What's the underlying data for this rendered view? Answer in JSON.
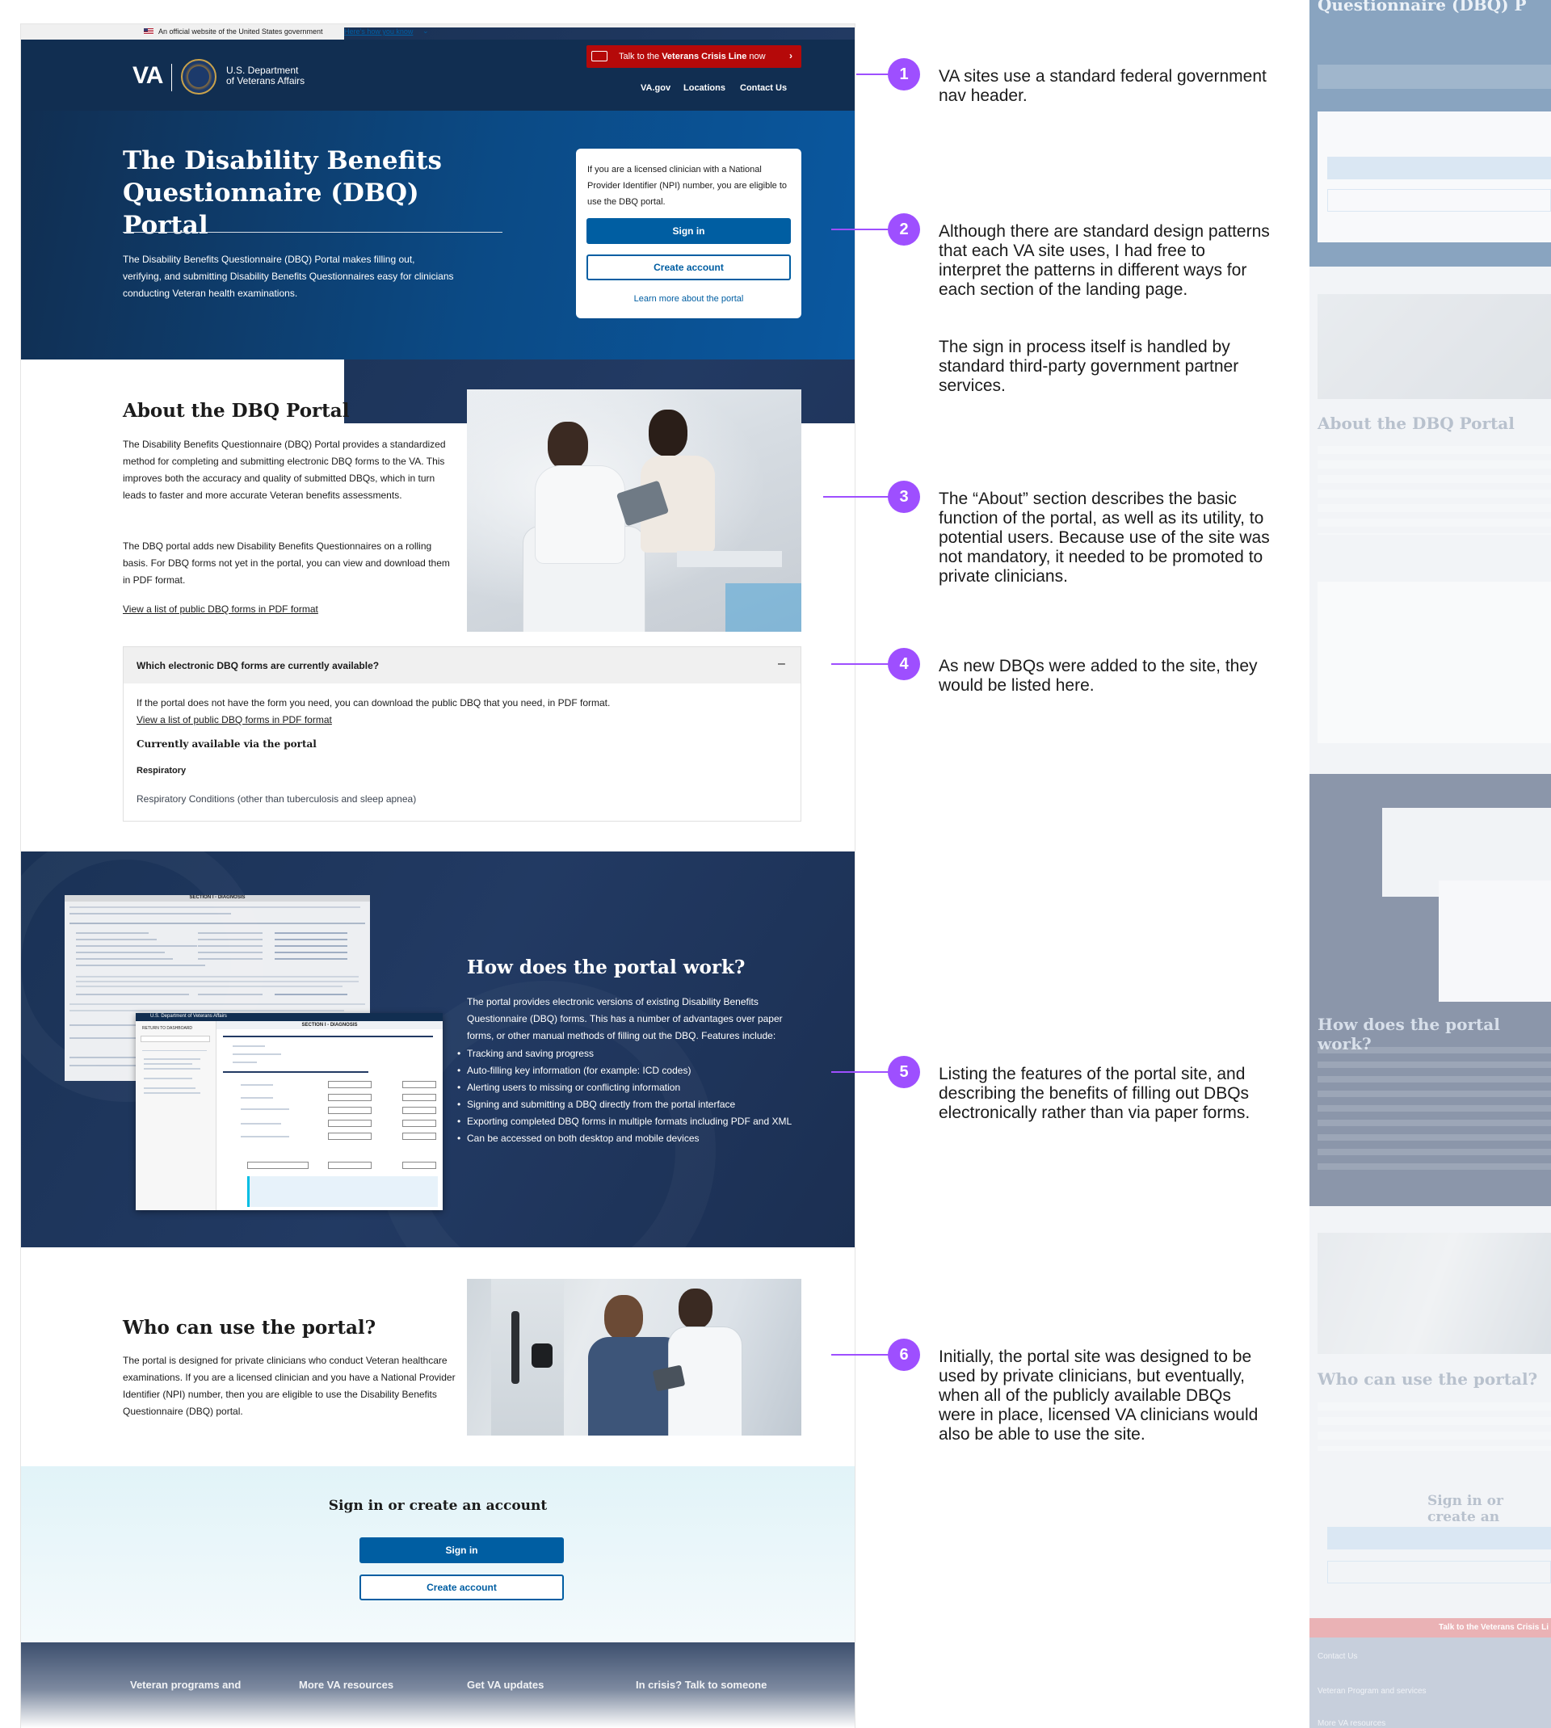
{
  "banner": {
    "text": "An official website of the United States government",
    "how_label": "Here’s how you know"
  },
  "crisis": {
    "prefix": "Talk to the ",
    "bold": "Veterans Crisis Line",
    "suffix": " now",
    "chevron": "›"
  },
  "header": {
    "logo": "VA",
    "dept_line1": "U.S. Department",
    "dept_line2": "of Veterans Affairs",
    "nav": [
      "VA.gov",
      "Locations",
      "Contact Us"
    ]
  },
  "hero": {
    "title": "The Disability Benefits Questionnaire (DBQ) Portal",
    "desc": "The Disability Benefits Questionnaire (DBQ) Portal makes filling out, verifying, and submitting Disability Benefits Questionnaires easy for clinicians conducting Veteran health examinations.",
    "card_text": "If you are a licensed clinician with a National Provider Identifier (NPI) number, you are eligible to use the DBQ portal.",
    "sign_in": "Sign in",
    "create": "Create account",
    "learn": "Learn more about the portal"
  },
  "about": {
    "title": "About the DBQ Portal",
    "p1": "The Disability Benefits Questionnaire (DBQ) Portal provides a standardized method for completing and submitting electronic DBQ forms to the VA. This improves both the accuracy and quality of submitted DBQs, which in turn leads to faster and more accurate Veteran benefits assessments.",
    "p2": "The DBQ portal adds new Disability Benefits Questionnaires on a rolling basis. For DBQ forms not yet in the portal, you can view and download them in PDF format.",
    "link": "View a list of public DBQ forms in PDF format"
  },
  "accordion": {
    "title": "Which electronic DBQ forms are currently available?",
    "toggle": "–",
    "text": "If the portal does not have the form you need, you can download the public DBQ that you need, in PDF format.",
    "link": "View a list of public DBQ forms in PDF format",
    "subhead": "Currently available via the portal",
    "category": "Respiratory",
    "item": "Respiratory Conditions (other than tuberculosis and sleep apnea)"
  },
  "how": {
    "title": "How does the portal work?",
    "intro": "The portal provides electronic versions of existing Disability Benefits Questionnaire (DBQ) forms. This has a number of advantages over paper forms, or other manual methods of filling out the DBQ. Features include:",
    "features": [
      "Tracking and saving progress",
      "Auto-filling key information (for example: ICD codes)",
      "Alerting users to missing or conflicting information",
      "Signing and submitting a DBQ directly from the portal interface",
      "Exporting completed DBQ forms in multiple formats including PDF and XML",
      "Can be accessed on both desktop and mobile devices"
    ],
    "form_header": "SECTION I - DIAGNOSIS",
    "form_brand": "U.S. Department of Veterans Affairs",
    "form_back": "RETURN TO DASHBOARD"
  },
  "who": {
    "title": "Who can use the portal?",
    "text": "The portal is designed for private clinicians who conduct Veteran healthcare examinations. If you are a licensed clinician and you have a National Provider Identifier (NPI) number, then you are eligible to use the Disability Benefits Questionnaire (DBQ) portal."
  },
  "signup": {
    "title": "Sign in or create an account",
    "sign_in": "Sign in",
    "create": "Create account"
  },
  "footer": {
    "cols": [
      "Veteran programs and",
      "More VA resources",
      "Get VA updates",
      "In crisis? Talk to someone"
    ]
  },
  "callouts": [
    {
      "num": "1",
      "text": "VA sites use a standard federal government nav header."
    },
    {
      "num": "2",
      "text": "Although there are standard design patterns that each VA site uses, I had free to interpret the patterns in different ways for each section of the landing page.",
      "text2": "The sign in process itself is handled by standard third-party government partner services."
    },
    {
      "num": "3",
      "text": "The “About” section describes the basic function of the portal, as well as its utility, to potential users. Because use of the site was not mandatory, it needed to be promoted to private clinicians."
    },
    {
      "num": "4",
      "text": "As new DBQs were added to the site, they would be listed here."
    },
    {
      "num": "5",
      "text": "Listing the features of the portal site, and describing the benefits of filling out DBQs electronically rather than via paper forms."
    },
    {
      "num": "6",
      "text": "Initially, the portal site was designed to be used by private clinicians, but eventually, when all of the publicly available DBQs were in place, licensed VA clinicians would also be able to use the site."
    }
  ],
  "mobile": {
    "title": "Questionnaire (DBQ) P",
    "about": "About the DBQ Portal",
    "how": "How does the portal work?",
    "who": "Who can use the portal?",
    "signup": "Sign in or create an",
    "crisis": "Talk to the Veterans Crisis Li",
    "footer": [
      "Contact Us",
      "Veteran Program and services",
      "More VA resources"
    ]
  },
  "colors": {
    "navy": "#112e51",
    "primary": "#005ea2",
    "crisis": "#b50909",
    "callout": "#9e4fff"
  }
}
